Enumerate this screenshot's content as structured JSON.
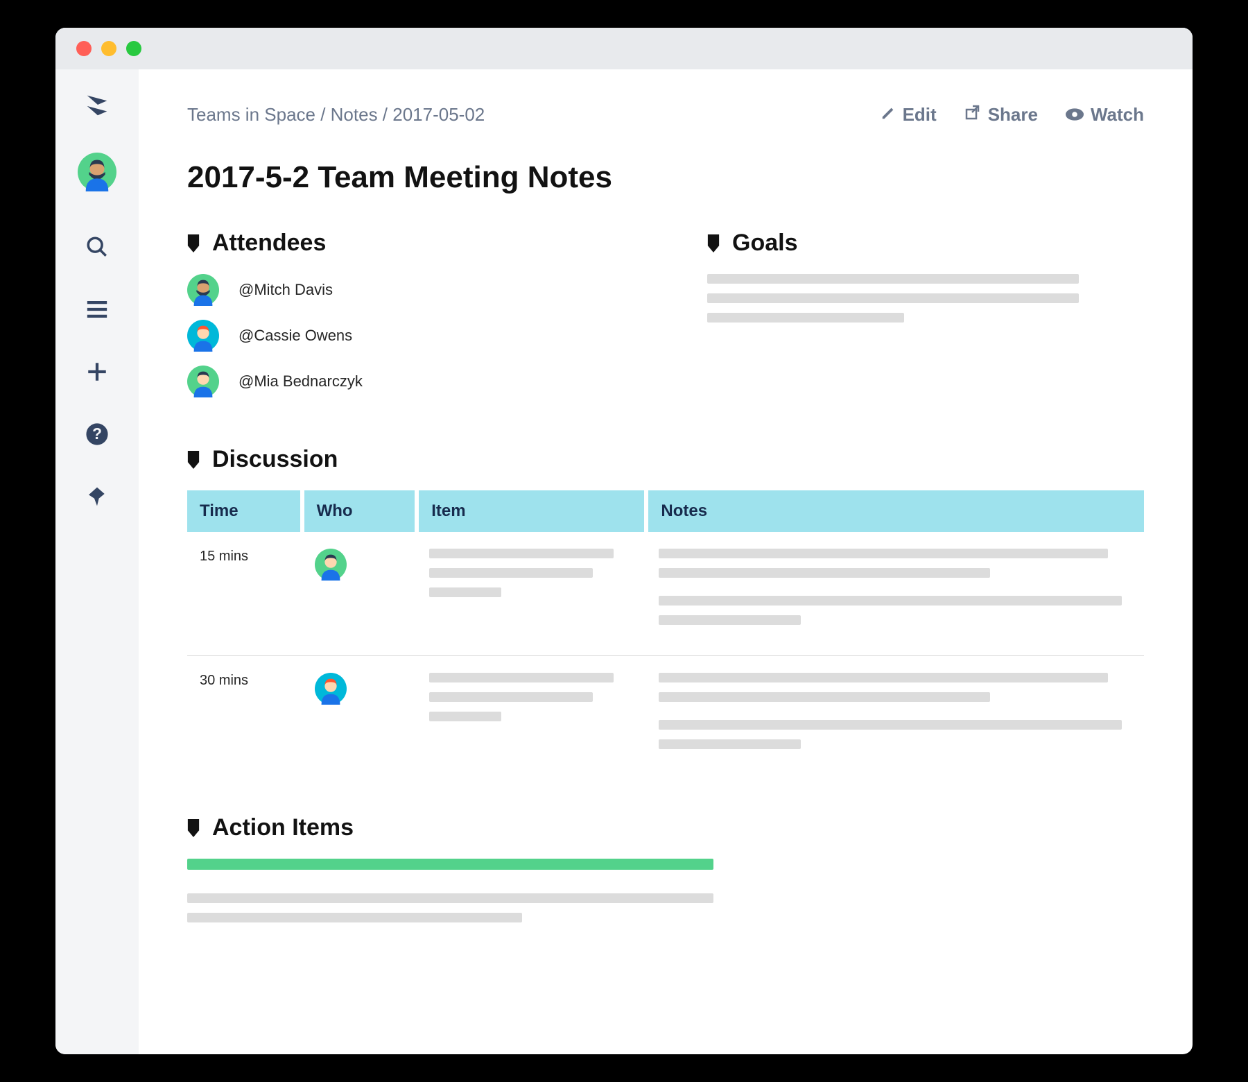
{
  "breadcrumb": [
    "Teams in Space",
    "Notes",
    "2017-05-02"
  ],
  "actions": {
    "edit": "Edit",
    "share": "Share",
    "watch": "Watch"
  },
  "page_title": "2017-5-2 Team Meeting Notes",
  "sections": {
    "attendees": "Attendees",
    "goals": "Goals",
    "discussion": "Discussion",
    "action_items": "Action Items"
  },
  "attendees": [
    {
      "name": "@Mitch Davis",
      "avatar": "mitch"
    },
    {
      "name": "@Cassie Owens",
      "avatar": "cassie"
    },
    {
      "name": "@Mia Bednarczyk",
      "avatar": "mia"
    }
  ],
  "discussion_columns": [
    "Time",
    "Who",
    "Item",
    "Notes"
  ],
  "discussion_rows": [
    {
      "time": "15 mins",
      "who": "mia"
    },
    {
      "time": "30 mins",
      "who": "cassie"
    }
  ],
  "avatars": {
    "mitch": {
      "bg": "#53d28b",
      "skin": "#d9a270",
      "hair": "#2a3a50",
      "shirt": "#1a73e8"
    },
    "cassie": {
      "bg": "#00b8d9",
      "skin": "#ffd7b0",
      "hair": "#ff5630",
      "shirt": "#1a73e8"
    },
    "mia": {
      "bg": "#53d28b",
      "skin": "#ffd7b0",
      "hair": "#2a3a50",
      "shirt": "#1a73e8"
    }
  }
}
